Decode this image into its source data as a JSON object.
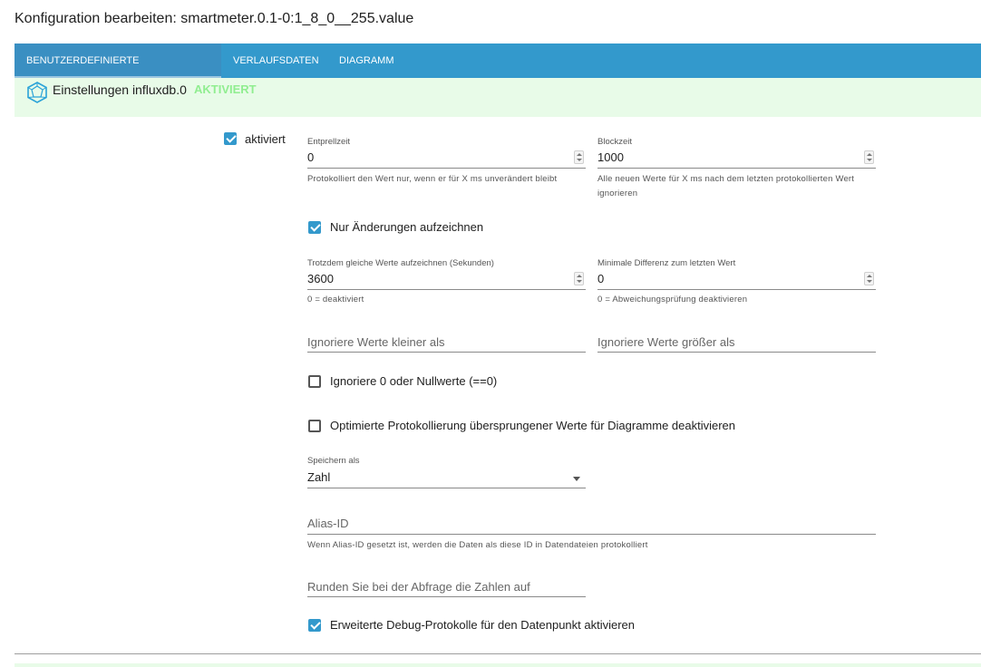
{
  "title": "Konfiguration bearbeiten: smartmeter.0.1-0:1_8_0__255.value",
  "tabs": [
    {
      "label": "BENUTZERDEFINIERTE EINSTELLUNGEN",
      "active": true
    },
    {
      "label": "VERLAUFSDATEN",
      "active": false
    },
    {
      "label": "DIAGRAMM",
      "active": false
    }
  ],
  "instance": {
    "name": "Einstellungen influxdb.0",
    "status": "AKTIVIERT",
    "icon": "influxdb-icon",
    "status_color": "#90ee90"
  },
  "enabled": {
    "label": "aktiviert",
    "checked": true
  },
  "debounce": {
    "label": "Entprellzeit",
    "value": "0",
    "help": "Protokolliert den Wert nur, wenn er für X ms unverändert bleibt"
  },
  "blocktime": {
    "label": "Blockzeit",
    "value": "1000",
    "help": "Alle neuen Werte für X ms nach dem letzten protokollierten Wert ignorieren"
  },
  "changes_only": {
    "label": "Nur Änderungen aufzeichnen",
    "checked": true
  },
  "still_record": {
    "label": "Trotzdem gleiche Werte aufzeichnen (Sekunden)",
    "value": "3600",
    "help": "0 = deaktiviert"
  },
  "min_diff": {
    "label": "Minimale Differenz zum letzten Wert",
    "value": "0",
    "help": "0 = Abweichungsprüfung deaktivieren"
  },
  "ignore_below": {
    "placeholder": "Ignoriere Werte kleiner als"
  },
  "ignore_above": {
    "placeholder": "Ignoriere Werte größer als"
  },
  "ignore_zero": {
    "label": "Ignoriere 0 oder Nullwerte (==0)",
    "checked": false
  },
  "disable_skipped": {
    "label": "Optimierte Protokollierung übersprungener Werte für Diagramme deaktivieren",
    "checked": false
  },
  "store_as": {
    "label": "Speichern als",
    "value": "Zahl"
  },
  "alias": {
    "placeholder": "Alias-ID",
    "help": "Wenn Alias-ID gesetzt ist, werden die Daten als diese ID in Datendateien protokolliert"
  },
  "round": {
    "placeholder": "Runden Sie bei der Abfrage die Zahlen auf"
  },
  "debug": {
    "label": "Erweiterte Debug-Protokolle für den Datenpunkt aktivieren",
    "checked": true
  },
  "colors": {
    "accent": "#3399cc",
    "instance_bg": "#e8fbe8"
  }
}
